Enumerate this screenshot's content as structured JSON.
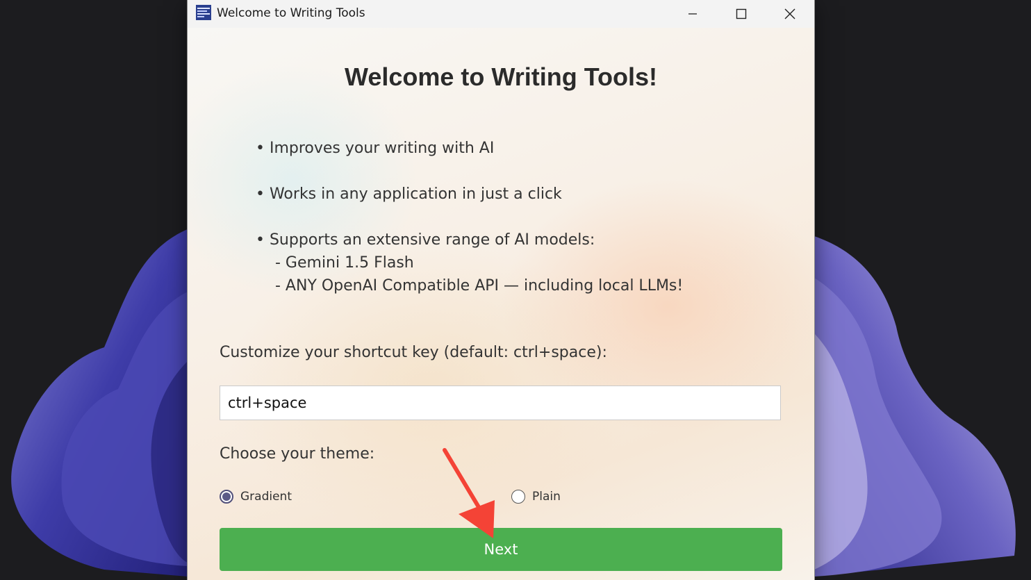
{
  "window": {
    "title": "Welcome to Writing Tools",
    "controls": {
      "minimize": "minimize-icon",
      "maximize": "maximize-icon",
      "close": "close-icon"
    }
  },
  "main": {
    "heading": "Welcome to Writing Tools!",
    "features": [
      "• Improves your writing with AI",
      "• Works in any application in just a click",
      "• Supports an extensive range of AI models:"
    ],
    "models": [
      "- Gemini 1.5 Flash",
      "- ANY OpenAI Compatible API — including local LLMs!"
    ],
    "shortcut_label": "Customize your shortcut key (default: ctrl+space):",
    "shortcut_value": "ctrl+space",
    "theme_label": "Choose your theme:",
    "theme_options": [
      {
        "label": "Gradient",
        "selected": true
      },
      {
        "label": "Plain",
        "selected": false
      }
    ],
    "next_label": "Next"
  },
  "colors": {
    "next_button": "#4caf50",
    "radio_selected": "#5b5a87",
    "annotation_arrow": "#f44336"
  }
}
